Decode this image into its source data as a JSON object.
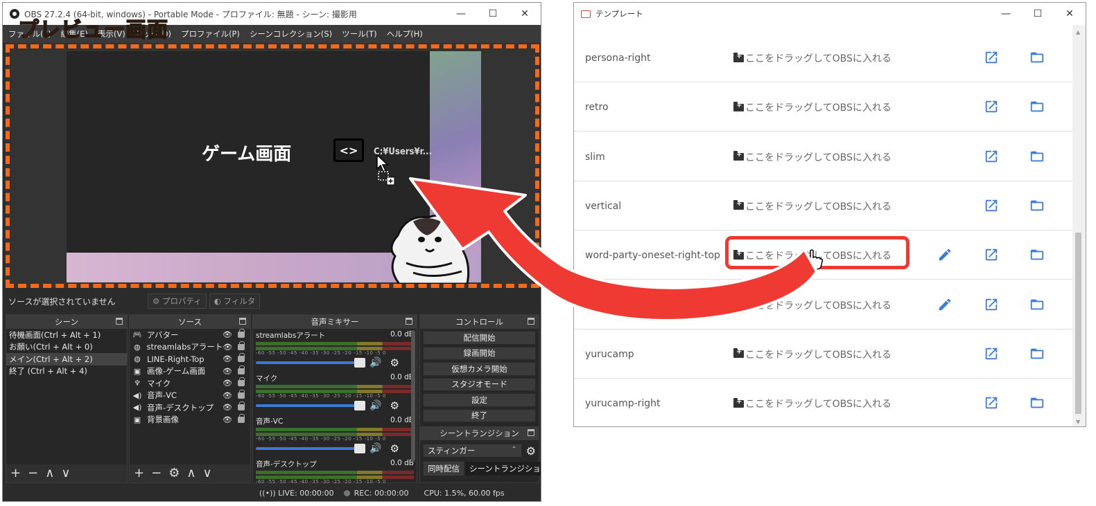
{
  "obs": {
    "title": "OBS 27.2.4 (64-bit, windows) - Portable Mode - プロファイル: 無題 - シーン: 撮影用",
    "menu": [
      "ファイル(F)",
      "編集(E)",
      "表示(V)",
      "ドック(D)",
      "プロファイル(P)",
      "シーンコレクション(S)",
      "ツール(T)",
      "ヘルプ(H)"
    ],
    "preview_annotation": "プレビュー画面",
    "game_label": "ゲーム画面",
    "code_icon": "<>",
    "path_label": "C:¥Users¥r...",
    "no_source_selected": "ソースが選択されていません",
    "properties_btn": "プロパティ",
    "filters_btn": "フィルタ",
    "scenes": {
      "header": "シーン",
      "items": [
        "待機画面(Ctrl + Alt + 1)",
        "お願い(Ctrl + Alt + 0)",
        "メイン(Ctrl + Alt + 2)",
        "終了 (Ctrl + Alt + 4)"
      ],
      "selected_index": 2
    },
    "sources": {
      "header": "ソース",
      "items": [
        {
          "icon": "gamepad-icon",
          "label": "アバター"
        },
        {
          "icon": "globe-icon",
          "label": "streamlabsアラート"
        },
        {
          "icon": "globe-icon",
          "label": "LINE-Right-Top"
        },
        {
          "icon": "image-icon",
          "label": "画像-ゲーム画面"
        },
        {
          "icon": "mic-icon",
          "label": "マイク"
        },
        {
          "icon": "speaker-icon",
          "label": "音声-VC"
        },
        {
          "icon": "speaker-icon",
          "label": "音声-デスクトップ"
        },
        {
          "icon": "image-icon",
          "label": "背景画像"
        }
      ]
    },
    "mixer": {
      "header": "音声ミキサー",
      "ticks": "-60 -55 -50 -45 -40 -35 -30 -25 -20 -15 -10 -5 0",
      "channels": [
        {
          "name": "streamlabsアラート",
          "db": "0.0 dB",
          "volume": 1.0
        },
        {
          "name": "マイク",
          "db": "0.0 dB",
          "volume": 1.0
        },
        {
          "name": "音声-VC",
          "db": "0.0 dB",
          "volume": 1.0
        },
        {
          "name": "音声-デスクトップ",
          "db": "0.0 dB",
          "volume": 1.0
        }
      ]
    },
    "controls": {
      "header": "コントロール",
      "buttons": [
        "配信開始",
        "録画開始",
        "仮想カメラ開始",
        "スタジオモード",
        "設定",
        "終了"
      ]
    },
    "transitions": {
      "header": "シーントランジション",
      "selected": "スティンガー",
      "tabs": [
        "同時配信",
        "シーントランジション"
      ]
    },
    "status": {
      "live": "LIVE: 00:00:00",
      "rec": "REC: 00:00:00",
      "cpu": "CPU: 1.5%, 60.00 fps"
    }
  },
  "template": {
    "title": "テンプレート",
    "drag_text": "ここをドラッグしてOBSに入れる",
    "rows": [
      {
        "name": "persona-right",
        "editable": false
      },
      {
        "name": "retro",
        "editable": false
      },
      {
        "name": "slim",
        "editable": false
      },
      {
        "name": "vertical",
        "editable": false
      },
      {
        "name": "word-party-oneset-right-top",
        "editable": true
      },
      {
        "name": "wor",
        "editable": true
      },
      {
        "name": "yurucamp",
        "editable": false
      },
      {
        "name": "yurucamp-right",
        "editable": false
      }
    ]
  },
  "colors": {
    "annotation_orange": "#f46a1c",
    "highlight_red": "#ee3a33",
    "icon_blue": "#3b7dd8"
  }
}
